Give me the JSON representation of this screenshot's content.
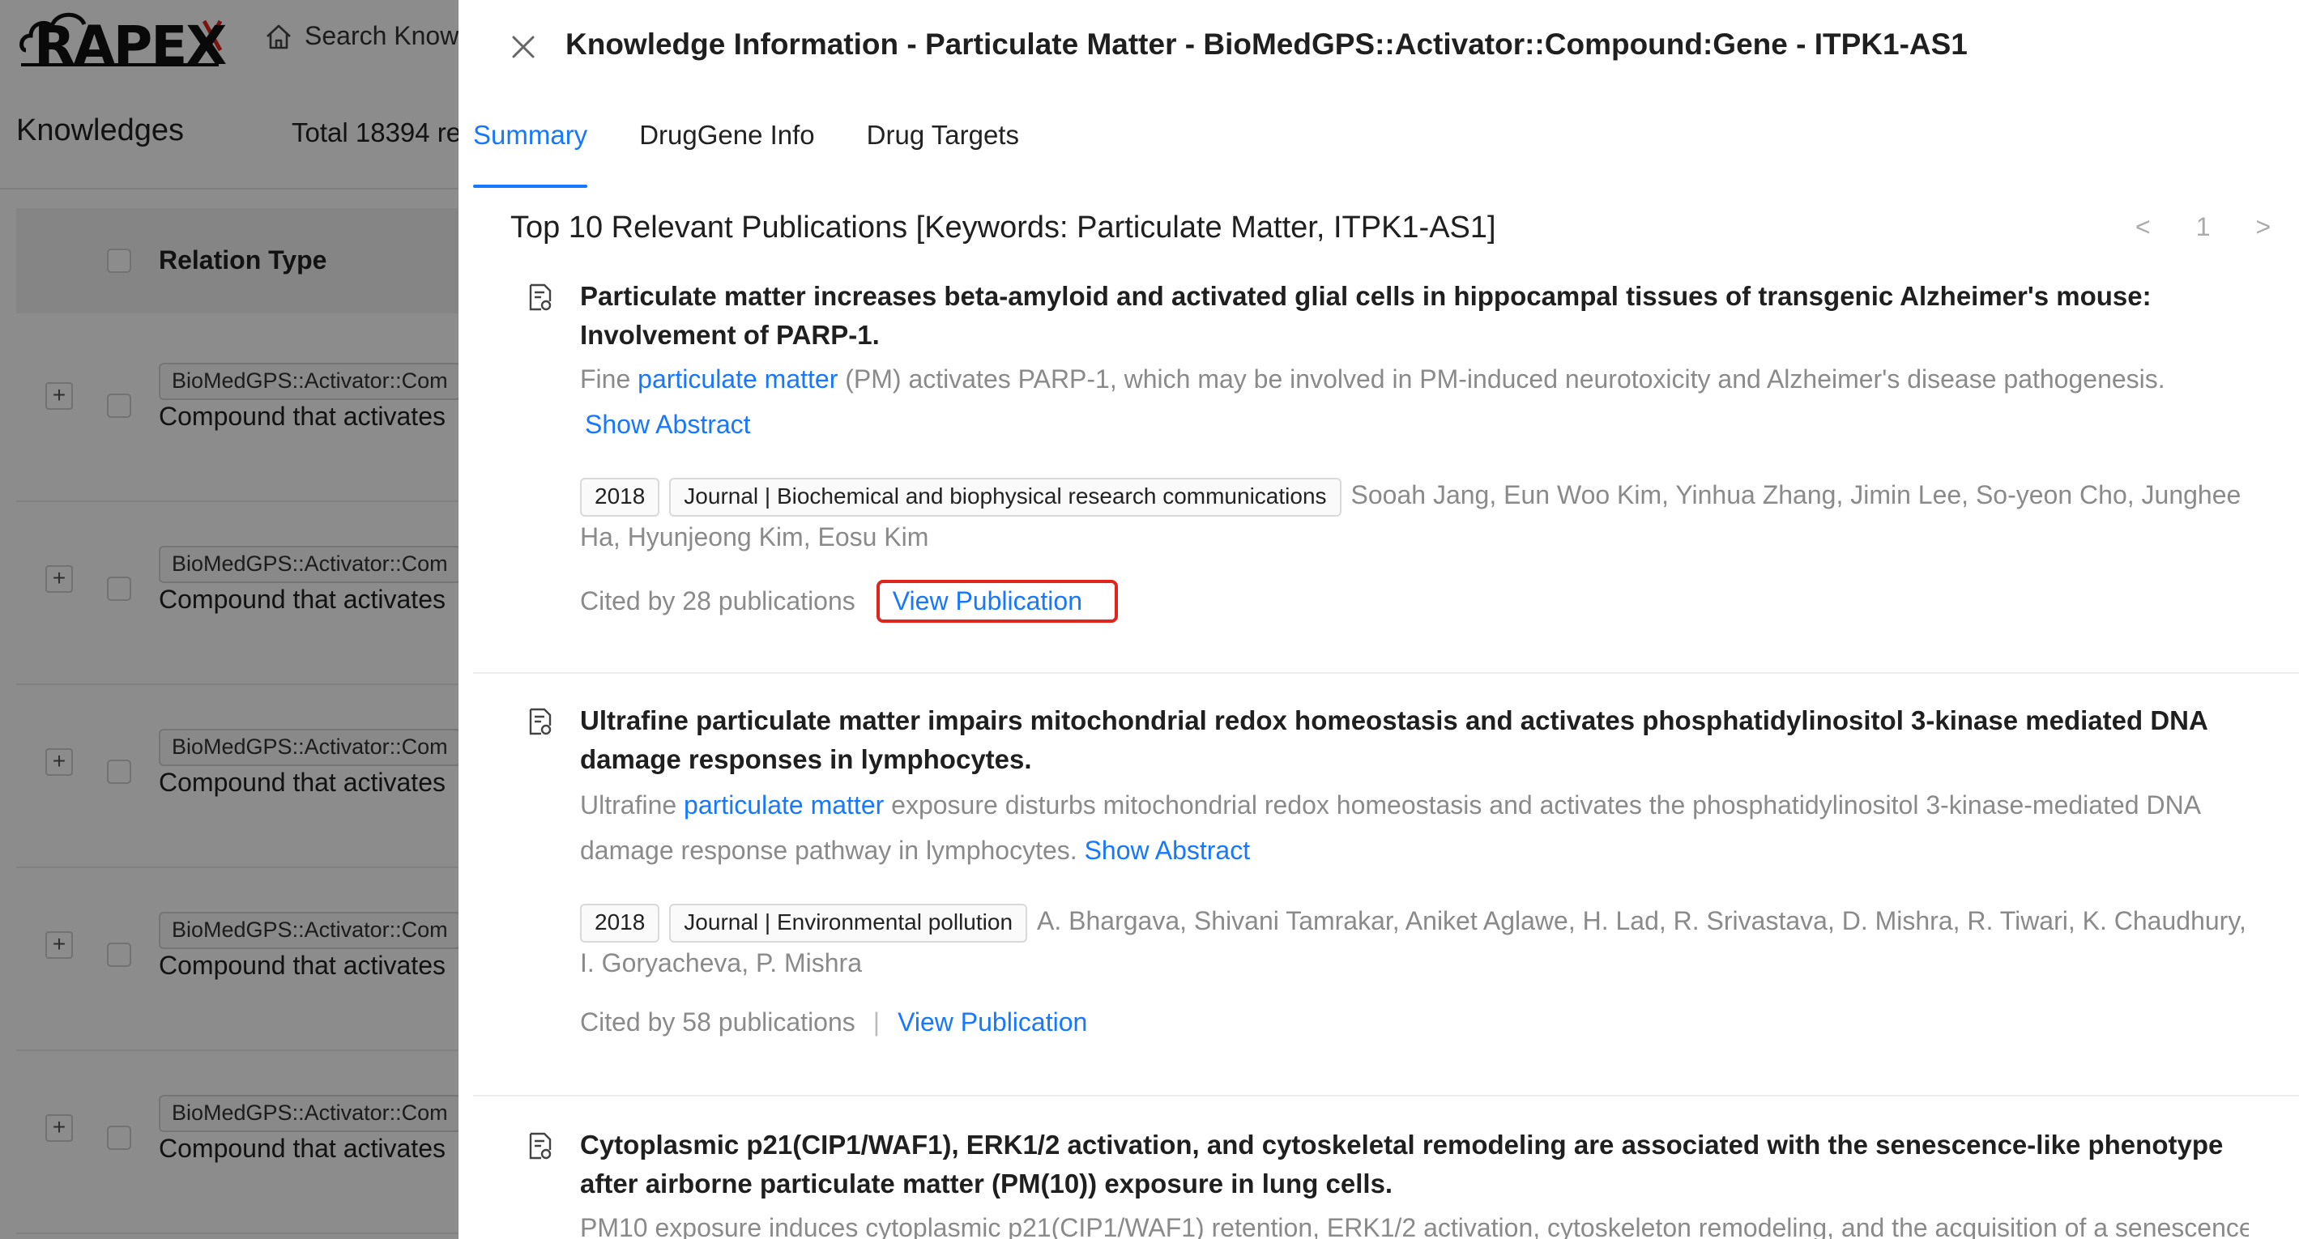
{
  "app": {
    "logo_text": "RAPEX",
    "nav_search_label": "Search Know",
    "page_title": "Knowledges",
    "total_text": "Total 18394 re",
    "table_header_label": "Relation Type",
    "rows": [
      {
        "tag": "BioMedGPS::Activator::Com",
        "desc": "Compound that activates"
      },
      {
        "tag": "BioMedGPS::Activator::Com",
        "desc": "Compound that activates"
      },
      {
        "tag": "BioMedGPS::Activator::Com",
        "desc": "Compound that activates"
      },
      {
        "tag": "BioMedGPS::Activator::Com",
        "desc": "Compound that activates"
      },
      {
        "tag": "BioMedGPS::Activator::Com",
        "desc": "Compound that activates"
      }
    ]
  },
  "drawer": {
    "title": "Knowledge Information - Particulate Matter - BioMedGPS::Activator::Compound:Gene - ITPK1-AS1",
    "tabs": [
      {
        "label": "Summary",
        "active": true
      },
      {
        "label": "DrugGene Info",
        "active": false
      },
      {
        "label": "Drug Targets",
        "active": false
      }
    ],
    "section_title": "Top 10 Relevant Publications [Keywords: Particulate Matter, ITPK1-AS1]",
    "pager": {
      "prev": "<",
      "current": "1",
      "next": ">"
    },
    "publications": [
      {
        "title": "Particulate matter increases beta-amyloid and activated glial cells in hippocampal tissues of transgenic Alzheimer's mouse: Involvement of PARP-1.",
        "summary_pre": "Fine ",
        "summary_hl": "particulate matter",
        "summary_post": " (PM) activates PARP-1, which may be involved in PM-induced neurotoxicity and Alzheimer's disease pathogenesis.",
        "show_abstract": "Show Abstract",
        "year": "2018",
        "journal": "Journal | Biochemical and biophysical research communications",
        "authors": "Sooah Jang, Eun Woo Kim, Yinhua Zhang, Jimin Lee, So-yeon Cho, Junghee Ha, Hyunjeong Kim, Eosu Kim",
        "cited": "Cited by 28 publications",
        "view": "View Publication"
      },
      {
        "title": "Ultrafine particulate matter impairs mitochondrial redox homeostasis and activates phosphatidylinositol 3-kinase mediated DNA damage responses in lymphocytes.",
        "summary_pre": "Ultrafine ",
        "summary_hl": "particulate matter",
        "summary_post": " exposure disturbs mitochondrial redox homeostasis and activates the phosphatidylinositol 3-kinase-mediated DNA damage response pathway in lymphocytes.",
        "show_abstract": "Show Abstract",
        "year": "2018",
        "journal": "Journal | Environmental pollution",
        "authors": "A. Bhargava, Shivani Tamrakar, Aniket Aglawe, H. Lad, R. Srivastava, D. Mishra, R. Tiwari, K. Chaudhury, I. Goryacheva, P. Mishra",
        "cited": "Cited by 58 publications",
        "view": "View Publication"
      },
      {
        "title": "Cytoplasmic p21(CIP1/WAF1), ERK1/2 activation, and cytoskeletal remodeling are associated with the senescence-like phenotype after airborne particulate matter (PM(10)) exposure in lung cells.",
        "summary": "PM10 exposure induces cytoplasmic p21(CIP1/WAF1) retention, ERK1/2 activation, cytoskeleton remodeling, and the acquisition of a senescence-"
      }
    ]
  }
}
